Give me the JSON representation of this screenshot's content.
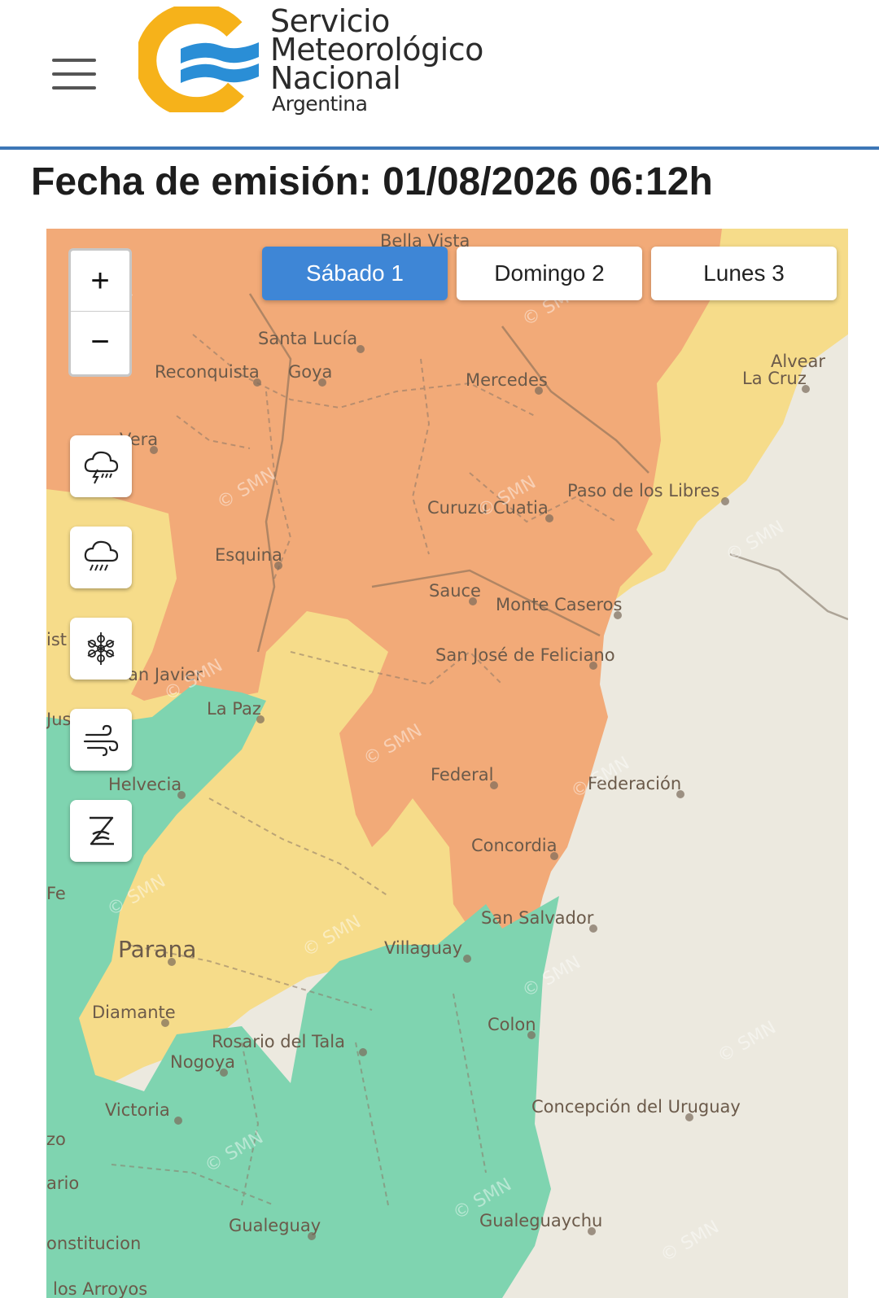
{
  "header": {
    "logo_text": [
      "Servicio",
      "Meteorológico",
      "Nacional",
      "Argentina"
    ],
    "menu_icon": "hamburger-menu-icon"
  },
  "issue_line": "Fecha de emisión: 01/08/2026 06:12h",
  "day_tabs": [
    {
      "label": "Sábado 1",
      "active": true
    },
    {
      "label": "Domingo 2",
      "active": false
    },
    {
      "label": "Lunes 3",
      "active": false
    }
  ],
  "zoom": {
    "in": "+",
    "out": "−"
  },
  "layer_buttons": [
    {
      "icon": "thunderstorm-icon"
    },
    {
      "icon": "rain-icon"
    },
    {
      "icon": "snow-icon"
    },
    {
      "icon": "wind-icon"
    },
    {
      "icon": "zonda-icon"
    }
  ],
  "colors": {
    "alert_orange": "#f2aa78",
    "alert_yellow": "#f6dc8a",
    "no_alert_green": "#7fd4b0",
    "background": "#ece9df",
    "active_tab": "#3e86d6",
    "header_rule": "#3d77b6"
  },
  "map_labels": [
    "Bella Vista",
    "Santa Lucía",
    "Reconquista",
    "Goya",
    "Mercedes",
    "Alvear",
    "La Cruz",
    "Vera",
    "Paso de los Libres",
    "Curuzu Cuatia",
    "Esquina",
    "Sauce",
    "Monte Caseros",
    "ist",
    "San José de Feliciano",
    "an Javier",
    "Jus",
    "La Paz",
    "Helvecia",
    "Federal",
    "Federación",
    "Concordia",
    "Fe",
    "San Salvador",
    "Parana",
    "Villaguay",
    "Diamante",
    "Colon",
    "Rosario del Tala",
    "Nogoya",
    "Victoria",
    "Concepción del Uruguay",
    "zo",
    "ario",
    "Gualeguay",
    "Gualeguaychu",
    "onstitucion",
    "los Arroyos"
  ],
  "watermark": "SMN"
}
